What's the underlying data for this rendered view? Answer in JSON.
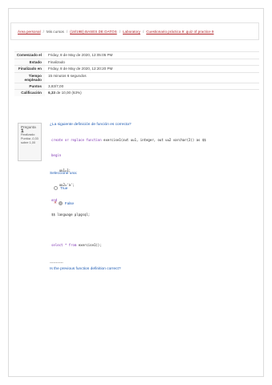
{
  "breadcrumb": {
    "items": [
      "Área personal",
      "Mis cursos",
      "(18/19B) BASES DE DATOS",
      "Laboratory",
      "Cuestionario práctica 9: quiz of practice 9"
    ],
    "separator": "/"
  },
  "summary": {
    "rows": [
      {
        "label": "Comenzado el",
        "value": "Friday, 8 de May de 2020, 12:05:05 PM"
      },
      {
        "label": "Estado",
        "value": "Finalizado"
      },
      {
        "label": "Finalizado en",
        "value": "Friday, 8 de May de 2020, 12:20:20 PM"
      },
      {
        "label": "Tiempo empleado",
        "value": "15 minutos 6 segundos"
      },
      {
        "label": "Puntos",
        "value": "3,83/7,00"
      },
      {
        "label": "Calificación",
        "value_bold": "6,33",
        "value_rest": " de 10,00 (63%)"
      }
    ]
  },
  "question": {
    "label": "Pregunta",
    "number": "1",
    "state": "Finalizado",
    "score": "Puntúa -0,33",
    "max": "sobre 1,00",
    "text": "¿La siguiente definición de función es correcta?",
    "code_lines": [
      {
        "kw": "create or replace function",
        "rest": " exercise1(out uu1, integer, out uu2 varchar(2)) as $$"
      },
      {
        "kw": "begin",
        "rest": ""
      },
      {
        "kw": "",
        "rest": "    uu1=1;"
      },
      {
        "kw": "",
        "rest": "    uu2='a';"
      },
      {
        "kw": "end",
        "rest": ""
      },
      {
        "kw": "",
        "rest": "$$ language plpgsql;"
      },
      {
        "kw": "",
        "rest": ""
      },
      {
        "kw": "select * from",
        "rest": " exercise1();"
      }
    ],
    "dashes": "-----------",
    "text_en": "Is the previous function definition correct?",
    "select_one": "Seleccione una:",
    "options": [
      "True",
      "False"
    ]
  }
}
